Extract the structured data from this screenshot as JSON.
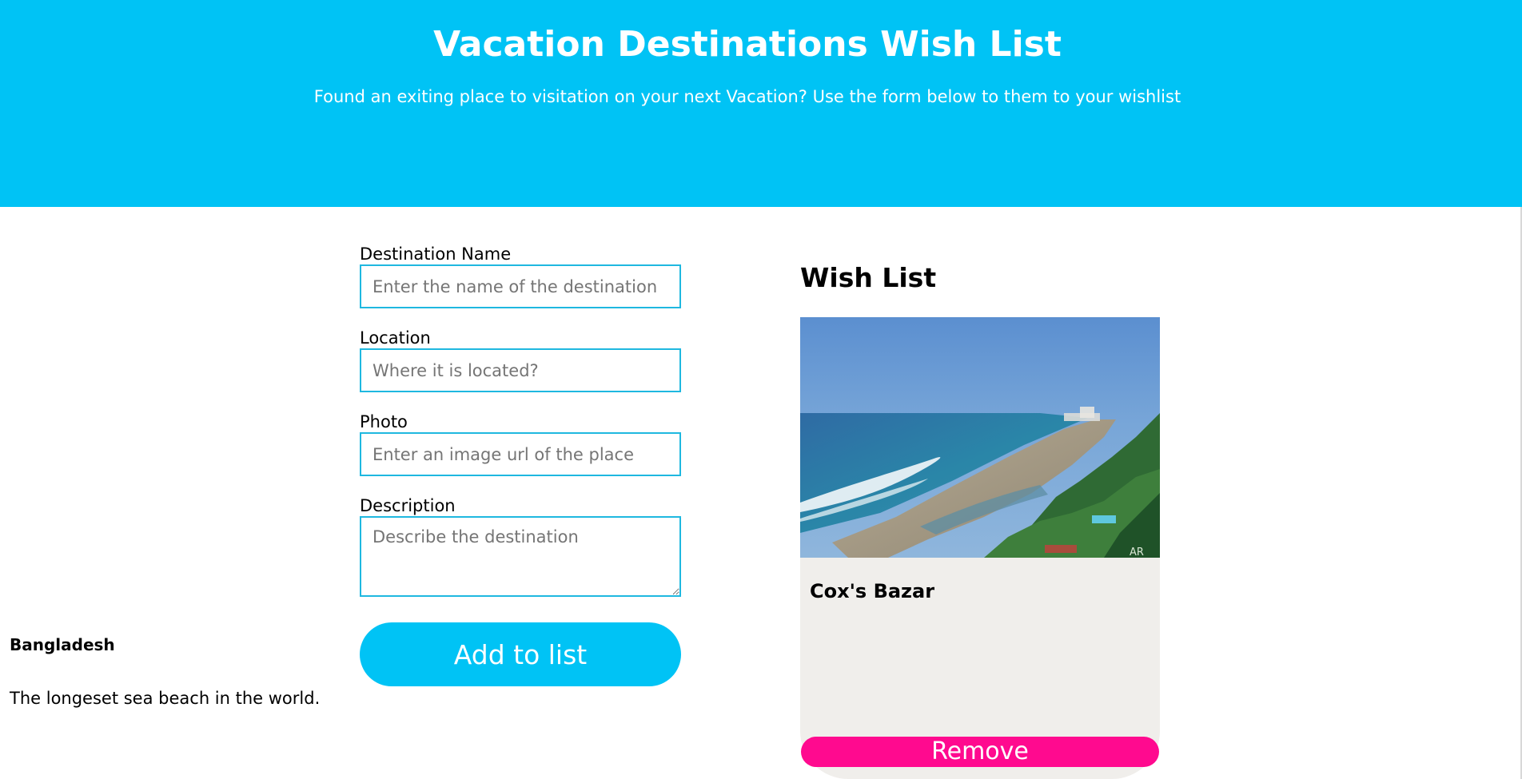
{
  "header": {
    "title": "Vacation Destinations Wish List",
    "subtitle": "Found an exiting place to visitation on your next Vacation? Use the form below to them to your wishlist",
    "background_color": "#00c3f5"
  },
  "form": {
    "destination_label": "Destination Name",
    "destination_placeholder": "Enter the name of the destination",
    "destination_value": "",
    "location_label": "Location",
    "location_placeholder": "Where it is located?",
    "location_value": "",
    "photo_label": "Photo",
    "photo_placeholder": "Enter an image url of the place",
    "photo_value": "",
    "description_label": "Description",
    "description_placeholder": "Describe the destination",
    "description_value": "",
    "submit_label": "Add to list",
    "submit_color": "#00c3f5"
  },
  "wishlist": {
    "title": "Wish List",
    "items": [
      {
        "name": "Cox's Bazar",
        "location": "Bangladesh",
        "description": "The longeset sea beach in the world.",
        "photo_watermark": "AR",
        "remove_label": "Remove",
        "remove_color": "#ff0a8f"
      }
    ]
  }
}
